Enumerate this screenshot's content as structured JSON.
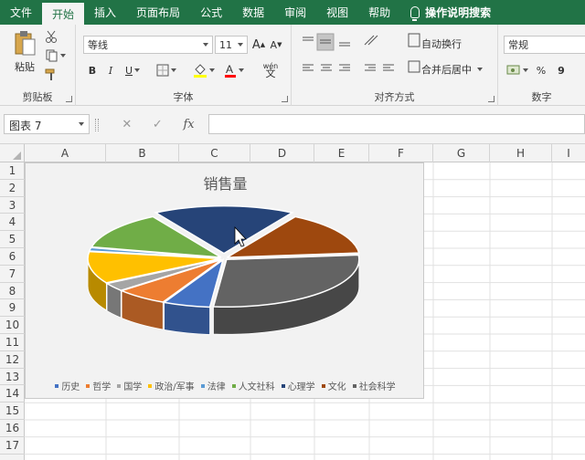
{
  "ribbon_tabs": [
    "文件",
    "开始",
    "插入",
    "页面布局",
    "公式",
    "数据",
    "审阅",
    "视图",
    "帮助"
  ],
  "active_tab": "开始",
  "tell_me": "操作说明搜索",
  "clipboard": {
    "paste": "粘贴",
    "label": "剪贴板"
  },
  "font": {
    "name": "等线",
    "size": "11",
    "bold": "B",
    "italic": "I",
    "underline": "U",
    "grow": "A",
    "shrink": "A",
    "label": "字体",
    "font_color_glyph": "A",
    "phonetic": "wén"
  },
  "alignment": {
    "wrap": "自动换行",
    "merge": "合并后居中",
    "label": "对齐方式"
  },
  "number": {
    "format": "常规",
    "percent": "%",
    "comma": "9",
    "label": "数字"
  },
  "formula_bar": {
    "name_box": "图表 7",
    "cancel": "✕",
    "enter": "✓",
    "fx": "fx",
    "value": ""
  },
  "columns": [
    "A",
    "B",
    "C",
    "D",
    "E",
    "F",
    "G",
    "H",
    "I"
  ],
  "rows": [
    "1",
    "2",
    "3",
    "4",
    "5",
    "6",
    "7",
    "8",
    "9",
    "10",
    "11",
    "12",
    "13",
    "14",
    "15",
    "16",
    "17"
  ],
  "chart_data": {
    "type": "pie",
    "title": "销售量",
    "categories": [
      "历史",
      "哲学",
      "国学",
      "政治/军事",
      "法律",
      "人文社科",
      "心理学",
      "文化",
      "社会科学"
    ],
    "values": [
      20,
      22,
      10,
      38,
      4,
      45,
      60,
      52,
      98
    ],
    "colors": [
      "#4472c4",
      "#ed7d31",
      "#a5a5a5",
      "#ffc000",
      "#5b9bd5",
      "#70ad47",
      "#264478",
      "#9e480e",
      "#636363"
    ],
    "legend_position": "bottom",
    "exploded_slice": "心理学"
  }
}
